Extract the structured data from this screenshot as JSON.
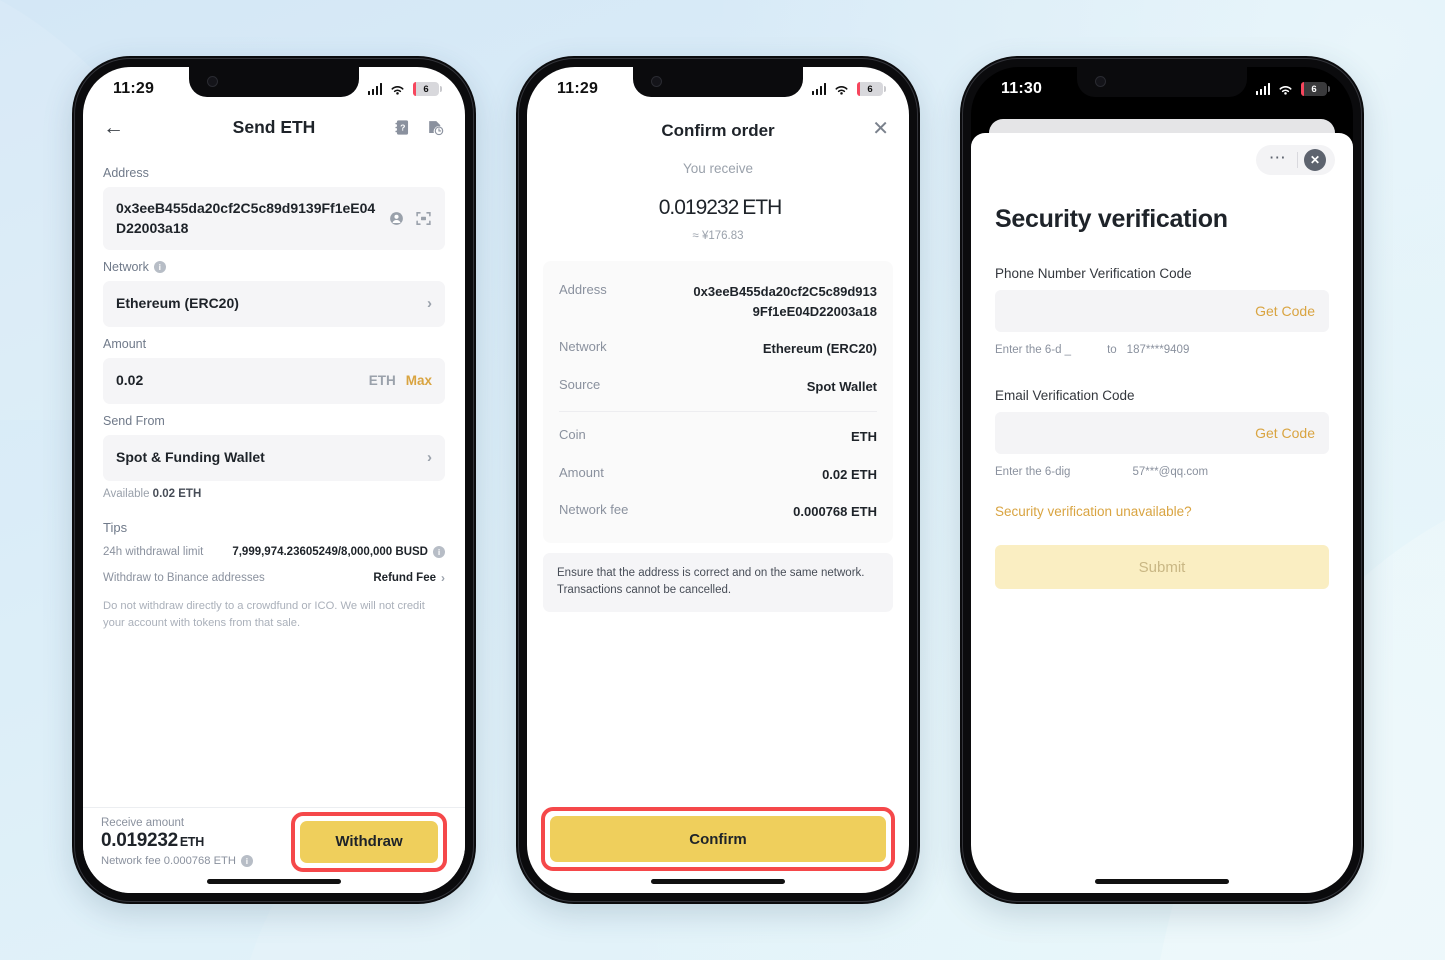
{
  "background": {
    "color_top": "#d4e7f6",
    "color_bottom": "#e6f5fa"
  },
  "accent": {
    "yellow": "#efcf5c",
    "yellow_text": "#d9a441",
    "highlight_red": "#f5484a"
  },
  "phone1": {
    "statusbar": {
      "time": "11:29",
      "battery": "6"
    },
    "nav": {
      "back_icon": "arrow-left-icon",
      "title": "Send ETH",
      "address_book_icon": "address-book-icon",
      "history_icon": "history-clock-icon"
    },
    "address": {
      "label": "Address",
      "value": "0x3eeB455da20cf2C5c89d9139Ff1eE04D22003a18",
      "contact_icon": "contact-person-icon",
      "scan_icon": "qr-scan-icon"
    },
    "network": {
      "label": "Network",
      "info_icon": "info-icon",
      "value": "Ethereum (ERC20)",
      "chevron": "›"
    },
    "amount": {
      "label": "Amount",
      "value": "0.02",
      "unit": "ETH",
      "max": "Max"
    },
    "send_from": {
      "label": "Send From",
      "value": "Spot & Funding Wallet",
      "chevron": "›",
      "available_label": "Available",
      "available_value": "0.02 ETH"
    },
    "tips": {
      "heading": "Tips",
      "rows": [
        {
          "label": "24h withdrawal limit",
          "value": "7,999,974.23605249/8,000,000 BUSD",
          "has_info": true,
          "has_chevron": false
        },
        {
          "label": "Withdraw to Binance addresses",
          "value": "Refund Fee",
          "has_info": false,
          "has_chevron": true
        }
      ],
      "note": "Do not withdraw directly to a crowdfund or ICO. We will not credit your account with tokens from that sale."
    },
    "bottom": {
      "receive_label": "Receive amount",
      "receive_amount": "0.019232",
      "receive_unit": "ETH",
      "network_fee": "Network fee 0.000768 ETH",
      "withdraw_button": "Withdraw"
    }
  },
  "phone2": {
    "statusbar": {
      "time": "11:29",
      "battery": "6"
    },
    "header": {
      "title": "Confirm order",
      "close_icon": "close-x-icon"
    },
    "receive": {
      "label": "You receive",
      "amount": "0.019232",
      "unit": "ETH",
      "fiat": "≈ ¥176.83"
    },
    "details_top": [
      {
        "key": "Address",
        "value": "0x3eeB455da20cf2C5c89d913 9Ff1eE04D22003a18"
      },
      {
        "key": "Network",
        "value": "Ethereum (ERC20)"
      },
      {
        "key": "Source",
        "value": "Spot Wallet"
      }
    ],
    "details_bottom": [
      {
        "key": "Coin",
        "value": "ETH"
      },
      {
        "key": "Amount",
        "value": "0.02 ETH"
      },
      {
        "key": "Network fee",
        "value": "0.000768 ETH"
      }
    ],
    "note": "Ensure that the address is correct and on the same network. Transactions cannot be cancelled.",
    "confirm_button": "Confirm"
  },
  "phone3": {
    "statusbar": {
      "time": "11:30",
      "battery": "6"
    },
    "controls": {
      "more_icon": "more-dots-icon",
      "close_icon": "close-circle-icon"
    },
    "title": "Security verification",
    "phone_section": {
      "label": "Phone Number Verification Code",
      "input_value": "",
      "get_code": "Get Code",
      "hint": "Enter the 6-d  _",
      "hint_to": "to",
      "destination": "187****9409"
    },
    "email_section": {
      "label": "Email Verification Code",
      "input_value": "",
      "get_code": "Get Code",
      "hint": "Enter the 6-dig",
      "destination": "57***@qq.com"
    },
    "unavailable_link": "Security verification unavailable?",
    "submit_button": "Submit"
  }
}
